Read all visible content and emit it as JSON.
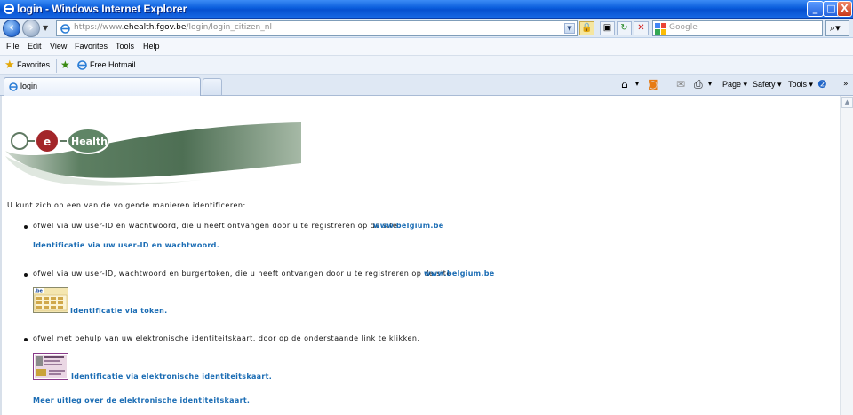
{
  "window": {
    "title": "login - Windows Internet Explorer",
    "buttons": {
      "minimize": "_",
      "maximize": "□",
      "close": "X"
    }
  },
  "address_bar": {
    "url_prefix": "https://www.",
    "url_domain": "ehealth.fgov.be",
    "url_path": "/login/login_citizen_nl",
    "search_placeholder": "Google"
  },
  "menu": [
    "File",
    "Edit",
    "View",
    "Favorites",
    "Tools",
    "Help"
  ],
  "favorites_bar": {
    "favorites_label": "Favorites",
    "link": "Free Hotmail"
  },
  "tabs": [
    {
      "label": "login"
    }
  ],
  "command_bar": {
    "page": "Page ▾",
    "safety": "Safety ▾",
    "tools": "Tools ▾"
  },
  "logo": {
    "text": "Health",
    "e": "e"
  },
  "content": {
    "intro": "U kunt zich op een van de volgende manieren identificeren:",
    "option1_text": "ofwel via uw user-ID en wachtwoord, die u heeft ontvangen door u te registreren op de site",
    "option1_site": "www.belgium.be",
    "option1_link": "Identificatie via uw user-ID en wachtwoord.",
    "option2_text": "ofwel via uw user-ID, wachtwoord en burgertoken, die u heeft ontvangen door u te registreren op de site",
    "option2_site": "www.belgium.be",
    "option2_link": "Identificatie via token.",
    "option3_text": "ofwel met behulp van uw elektronische identiteitskaart, door op de onderstaande link te klikken.",
    "option3_link": "Identificatie via elektronische identiteitskaart.",
    "more_link": "Meer uitleg over de elektronische identiteitskaart."
  }
}
